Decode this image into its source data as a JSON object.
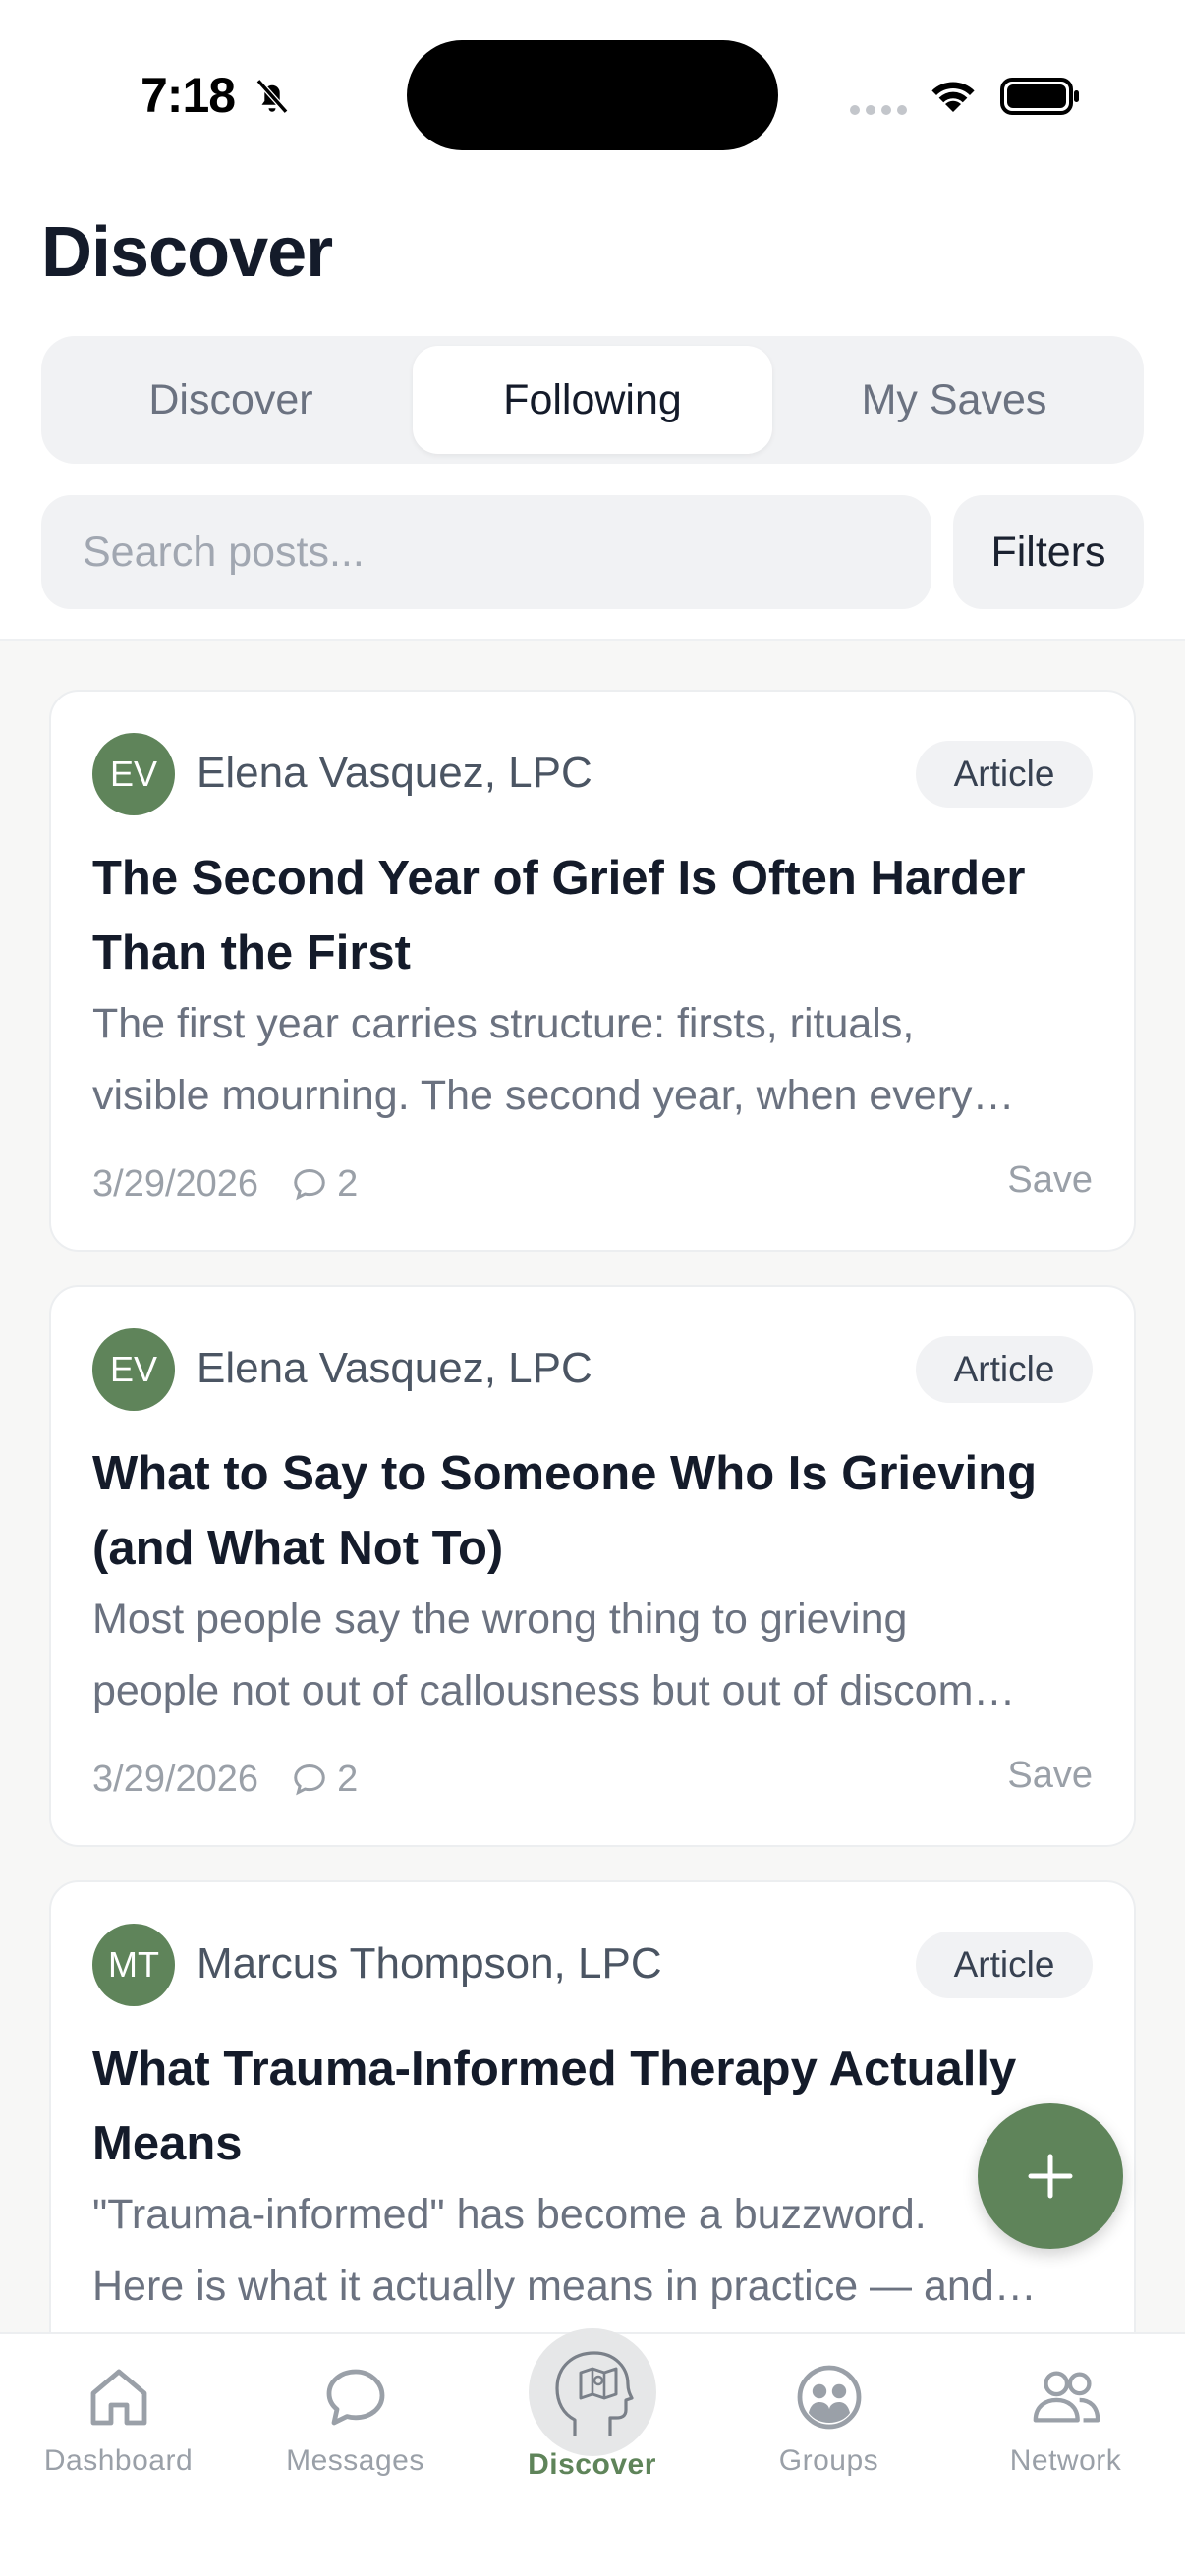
{
  "status_bar": {
    "time": "7:18"
  },
  "header": {
    "title": "Discover"
  },
  "tabs": [
    {
      "label": "Discover",
      "active": false
    },
    {
      "label": "Following",
      "active": true
    },
    {
      "label": "My Saves",
      "active": false
    }
  ],
  "search": {
    "placeholder": "Search posts...",
    "value": ""
  },
  "filters_label": "Filters",
  "posts": [
    {
      "initials": "EV",
      "author": "Elena Vasquez, LPC",
      "type": "Article",
      "title": "The Second Year of Grief Is Often Harder Than the First",
      "excerpt_line1": "The first year carries structure: firsts, rituals,",
      "excerpt_line2": "visible mourning. The second year, when every…",
      "date": "3/29/2026",
      "comments": "2",
      "save_label": "Save"
    },
    {
      "initials": "EV",
      "author": "Elena Vasquez, LPC",
      "type": "Article",
      "title": "What to Say to Someone Who Is Grieving (and What Not To)",
      "excerpt_line1": "Most people say the wrong thing to grieving",
      "excerpt_line2": "people not out of callousness but out of discom…",
      "date": "3/29/2026",
      "comments": "2",
      "save_label": "Save"
    },
    {
      "initials": "MT",
      "author": "Marcus Thompson, LPC",
      "type": "Article",
      "title": "What Trauma-Informed Therapy Actually Means",
      "excerpt_line1": "\"Trauma-informed\" has become a buzzword.",
      "excerpt_line2": "Here is what it actually means in practice — and…",
      "date": "",
      "comments": "",
      "save_label": ""
    }
  ],
  "bottom_nav": [
    {
      "label": "Dashboard",
      "icon": "home-icon",
      "active": false
    },
    {
      "label": "Messages",
      "icon": "chat-bubble-icon",
      "active": false
    },
    {
      "label": "Discover",
      "icon": "head-map-icon",
      "active": true
    },
    {
      "label": "Groups",
      "icon": "groups-icon",
      "active": false
    },
    {
      "label": "Network",
      "icon": "network-icon",
      "active": false
    }
  ],
  "colors": {
    "accent": "#5f845a",
    "text": "#141b2a",
    "muted": "#9aa0a8",
    "surface": "#f1f2f4"
  }
}
